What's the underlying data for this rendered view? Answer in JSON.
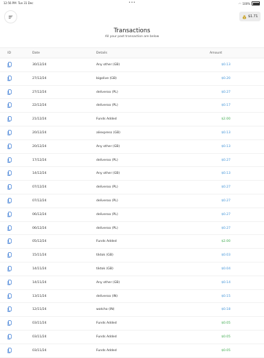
{
  "status_bar": {
    "time": "12:56 PM",
    "date": "Tue 31 Dec",
    "battery": "100%"
  },
  "header": {
    "balance": "$1.71",
    "title": "Transactions",
    "subtitle": "All your past transaction are below"
  },
  "table": {
    "headers": {
      "id": "ID",
      "date": "Date",
      "details": "Details",
      "amount": "Amount"
    },
    "rows": [
      {
        "date": "30/12/24",
        "details": "Any other (GB)",
        "amount": "$0.13",
        "type": "debit"
      },
      {
        "date": "27/12/24",
        "details": "bigolive (GB)",
        "amount": "$0.20",
        "type": "debit"
      },
      {
        "date": "27/12/24",
        "details": "deliveroo (PL)",
        "amount": "$0.27",
        "type": "debit"
      },
      {
        "date": "22/12/24",
        "details": "deliveroo (PL)",
        "amount": "$0.17",
        "type": "debit"
      },
      {
        "date": "21/12/24",
        "details": "Funds Added",
        "amount": "$2.00",
        "type": "credit"
      },
      {
        "date": "20/12/24",
        "details": "aliexpress (GB)",
        "amount": "$0.13",
        "type": "debit"
      },
      {
        "date": "20/12/24",
        "details": "Any other (GB)",
        "amount": "$0.13",
        "type": "debit"
      },
      {
        "date": "17/12/24",
        "details": "deliveroo (PL)",
        "amount": "$0.27",
        "type": "debit"
      },
      {
        "date": "14/12/24",
        "details": "Any other (GB)",
        "amount": "$0.13",
        "type": "debit"
      },
      {
        "date": "07/12/24",
        "details": "deliveroo (PL)",
        "amount": "$0.27",
        "type": "debit"
      },
      {
        "date": "07/12/24",
        "details": "deliveroo (PL)",
        "amount": "$0.27",
        "type": "debit"
      },
      {
        "date": "06/12/24",
        "details": "deliveroo (PL)",
        "amount": "$0.27",
        "type": "debit"
      },
      {
        "date": "06/12/24",
        "details": "deliveroo (PL)",
        "amount": "$0.27",
        "type": "debit"
      },
      {
        "date": "05/12/24",
        "details": "Funds Added",
        "amount": "$2.00",
        "type": "credit"
      },
      {
        "date": "15/11/24",
        "details": "tiktok (GB)",
        "amount": "$0.03",
        "type": "debit"
      },
      {
        "date": "14/11/24",
        "details": "tiktok (GB)",
        "amount": "$0.04",
        "type": "debit"
      },
      {
        "date": "14/11/24",
        "details": "Any other (GB)",
        "amount": "$0.14",
        "type": "debit"
      },
      {
        "date": "13/11/24",
        "details": "deliveroo (IN)",
        "amount": "$0.15",
        "type": "debit"
      },
      {
        "date": "12/11/24",
        "details": "watcho (IN)",
        "amount": "$0.18",
        "type": "debit"
      },
      {
        "date": "03/11/24",
        "details": "Funds Added",
        "amount": "$0.05",
        "type": "credit"
      },
      {
        "date": "03/11/24",
        "details": "Funds Added",
        "amount": "$0.05",
        "type": "credit"
      },
      {
        "date": "03/11/24",
        "details": "Funds Added",
        "amount": "$0.05",
        "type": "credit"
      }
    ]
  },
  "colors": {
    "debit": "#3a8fd6",
    "credit": "#3aa84a",
    "icon": "#3a7bd5"
  },
  "icons": {
    "menu": "menu-icon",
    "balance": "coin-bag-icon",
    "row": "document-icon"
  }
}
